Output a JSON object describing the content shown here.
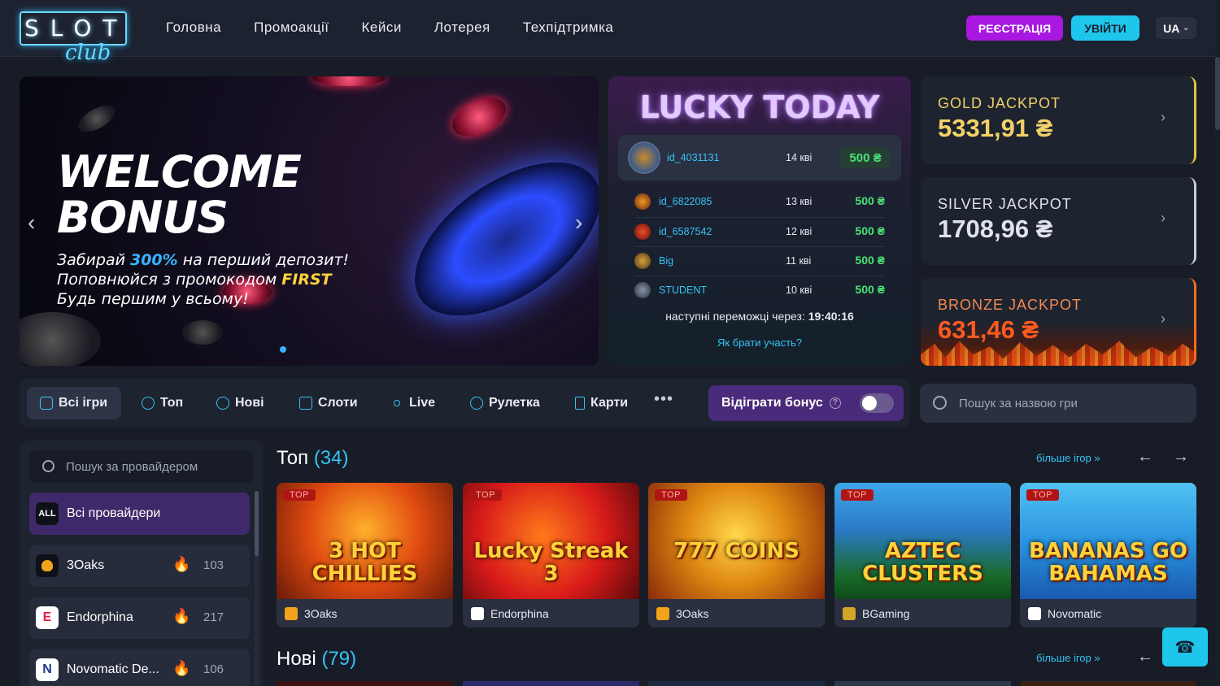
{
  "header": {
    "logo_text": "SLOT",
    "logo_script": "club",
    "nav": [
      "Головна",
      "Промоакції",
      "Кейси",
      "Лотерея",
      "Техпідтримка"
    ],
    "register_label": "РЕЄСТРАЦІЯ",
    "login_label": "УВІЙТИ",
    "lang": "UA"
  },
  "banner": {
    "title_line1": "WELCOME",
    "title_line2": "BONUS",
    "line1_pre": "Забирай ",
    "line1_hl": "300%",
    "line1_post": " на перший депозит!",
    "line2_pre": "Поповнюйся з промокодом ",
    "line2_hl": "FIRST",
    "line3": "Будь першим у всьому!"
  },
  "lucky_today": {
    "title": "LUCKY TODAY",
    "winners": [
      {
        "user": "id_4031131",
        "spins": "14 кві",
        "amount": "500 ₴"
      },
      {
        "user": "id_6822085",
        "spins": "13 кві",
        "amount": "500 ₴"
      },
      {
        "user": "id_6587542",
        "spins": "12 кві",
        "amount": "500 ₴"
      },
      {
        "user": "Big",
        "spins": "11 кві",
        "amount": "500 ₴"
      },
      {
        "user": "STUDENT",
        "spins": "10 кві",
        "amount": "500 ₴"
      }
    ],
    "next_label": "наступні переможці через: ",
    "next_time": "19:40:16",
    "how_label": "Як брати участь?"
  },
  "jackpots": {
    "gold": {
      "name": "GOLD JACKPOT",
      "value": "5331,91 ₴"
    },
    "silver": {
      "name": "SILVER JACKPOT",
      "value": "1708,96 ₴"
    },
    "bronze": {
      "name": "BRONZE JACKPOT",
      "value": "631,46 ₴"
    }
  },
  "categories": [
    {
      "label": "Всі ігри",
      "icon": "gamepad-icon"
    },
    {
      "label": "Топ",
      "icon": "top-icon"
    },
    {
      "label": "Нові",
      "icon": "new-icon"
    },
    {
      "label": "Слоти",
      "icon": "slots-icon"
    },
    {
      "label": "Live",
      "icon": "live-icon"
    },
    {
      "label": "Рулетка",
      "icon": "roulette-icon"
    },
    {
      "label": "Карти",
      "icon": "cards-icon"
    }
  ],
  "bonus_toggle": {
    "label": "Відіграти бонус",
    "enabled": false
  },
  "game_search_placeholder": "Пошук за назвою гри",
  "providers": {
    "search_placeholder": "Пошук за провайдером",
    "all_badge": "ALL",
    "all_label": "Всі провайдери",
    "items": [
      {
        "name": "3Oaks",
        "count": "103"
      },
      {
        "name": "Endorphina",
        "count": "217"
      },
      {
        "name": "Novomatic De...",
        "count": "106"
      }
    ]
  },
  "sections": {
    "top": {
      "title": "Топ",
      "count": "(34)",
      "more": "більше ігор »"
    },
    "new": {
      "title": "Нові",
      "count": "(79)",
      "more": "більше ігор »"
    }
  },
  "games": [
    {
      "title": "3 HOT CHILLIES",
      "provider": "3Oaks",
      "badge": "TOP"
    },
    {
      "title": "Lucky Streak 3",
      "provider": "Endorphina",
      "badge": "TOP"
    },
    {
      "title": "777 COINS",
      "provider": "3Oaks",
      "badge": "TOP"
    },
    {
      "title": "AZTEC CLUSTERS",
      "provider": "BGaming",
      "badge": "TOP"
    },
    {
      "title": "BANANAS GO BAHAMAS",
      "provider": "Novomatic",
      "badge": "TOP"
    }
  ],
  "colors": {
    "accent_purple": "#a818e0",
    "accent_cyan": "#1fc6ec",
    "win_green": "#4be276"
  }
}
